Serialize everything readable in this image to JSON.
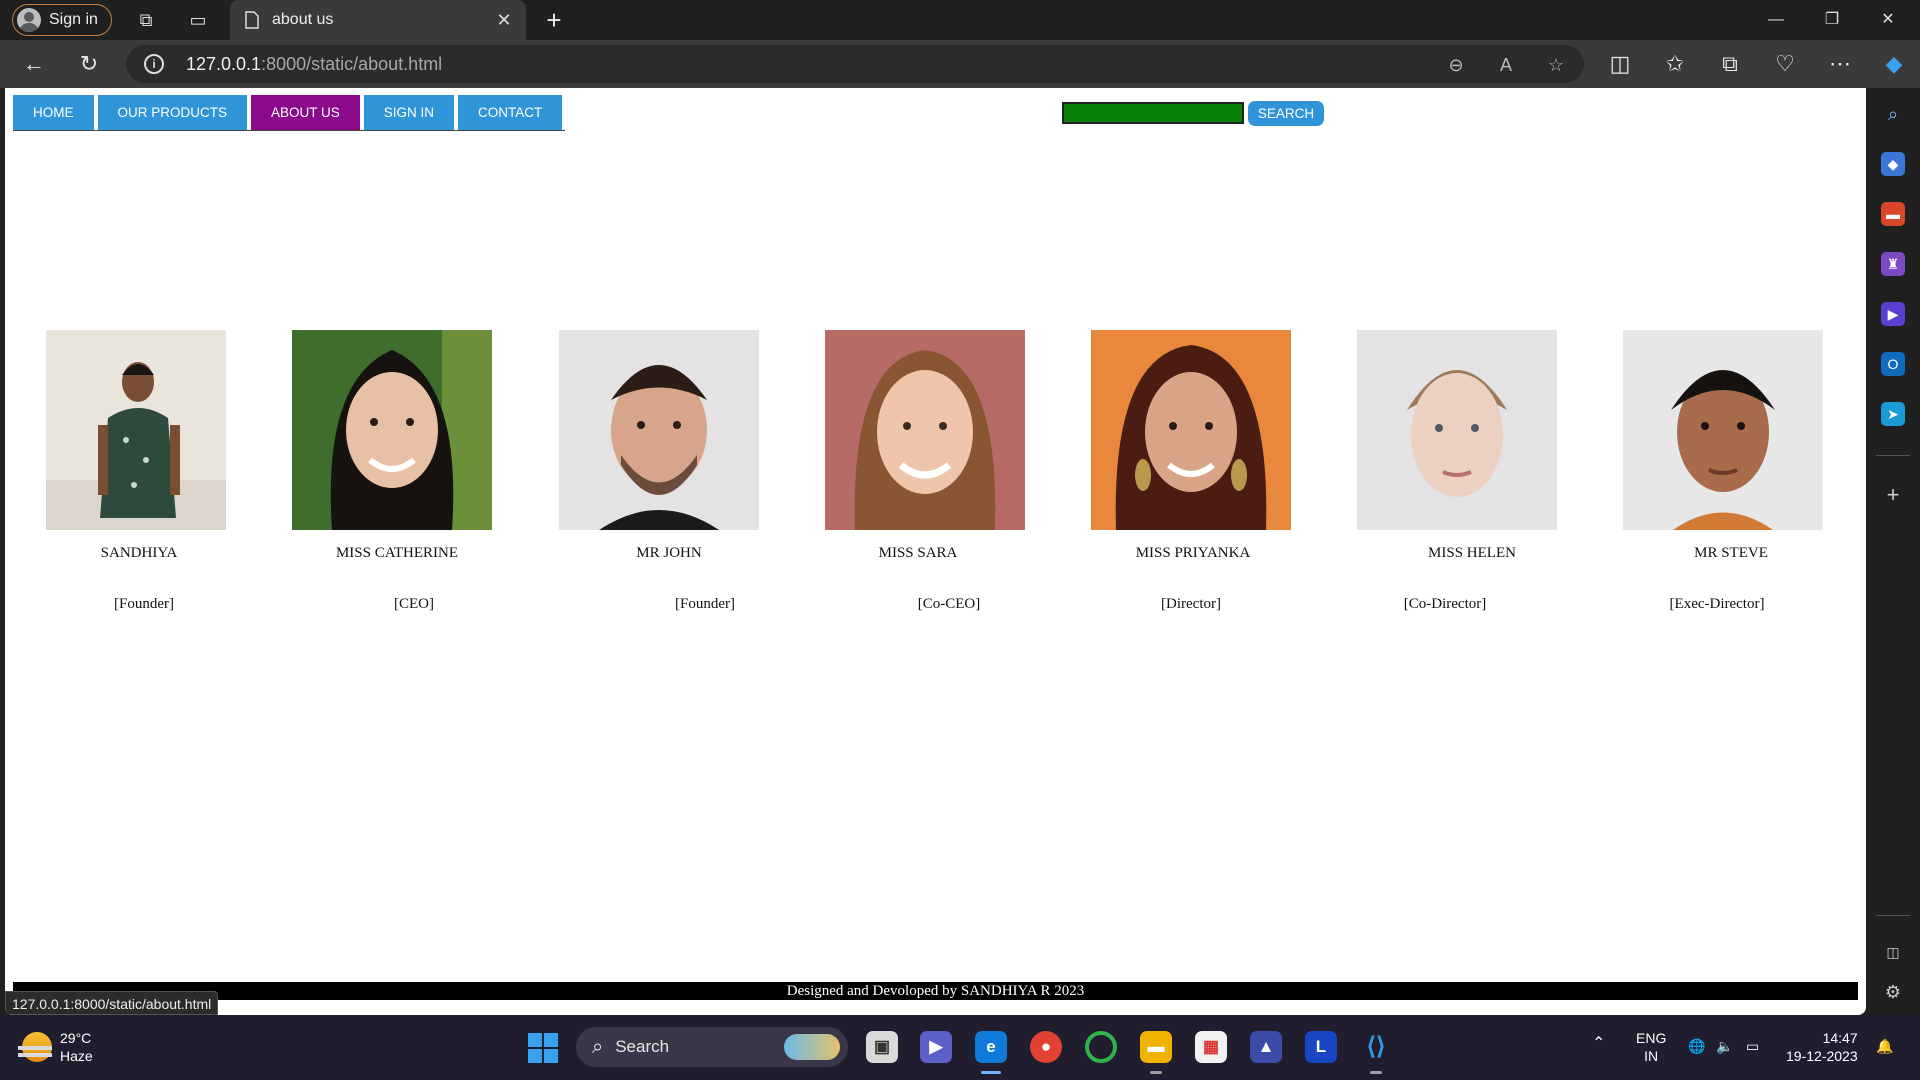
{
  "browser": {
    "signin_label": "Sign in",
    "tab_title": "about us",
    "url_host": "127.0.0.1",
    "url_rest": ":8000/static/about.html",
    "status_url": "127.0.0.1:8000/static/about.html"
  },
  "site": {
    "nav": [
      "HOME",
      "OUR PRODUCTS",
      "ABOUT US",
      "SIGN IN",
      "CONTACT"
    ],
    "active_nav": "ABOUT US",
    "search_label": "SEARCH",
    "members": [
      {
        "name": "SANDHIYA",
        "role": "[Founder]"
      },
      {
        "name": "MISS CATHERINE",
        "role": "[CEO]"
      },
      {
        "name": "MR JOHN",
        "role": "[Founder]"
      },
      {
        "name": "MISS SARA",
        "role": "[Co-CEO]"
      },
      {
        "name": "MISS PRIYANKA",
        "role": "[Director]"
      },
      {
        "name": "MISS HELEN",
        "role": "[Co-Director]"
      },
      {
        "name": "MR STEVE",
        "role": "[Exec-Director]"
      }
    ],
    "footer": "Designed and Devoloped by SANDHIYA R 2023"
  },
  "taskbar": {
    "temp": "29°C",
    "weather": "Haze",
    "search_label": "Search",
    "lang_top": "ENG",
    "lang_bottom": "IN",
    "time": "14:47",
    "date": "19-12-2023"
  },
  "colors": {
    "nav_blue": "#2f95d8",
    "nav_active": "#8b0a8b",
    "search_box": "#0a7f0a"
  }
}
